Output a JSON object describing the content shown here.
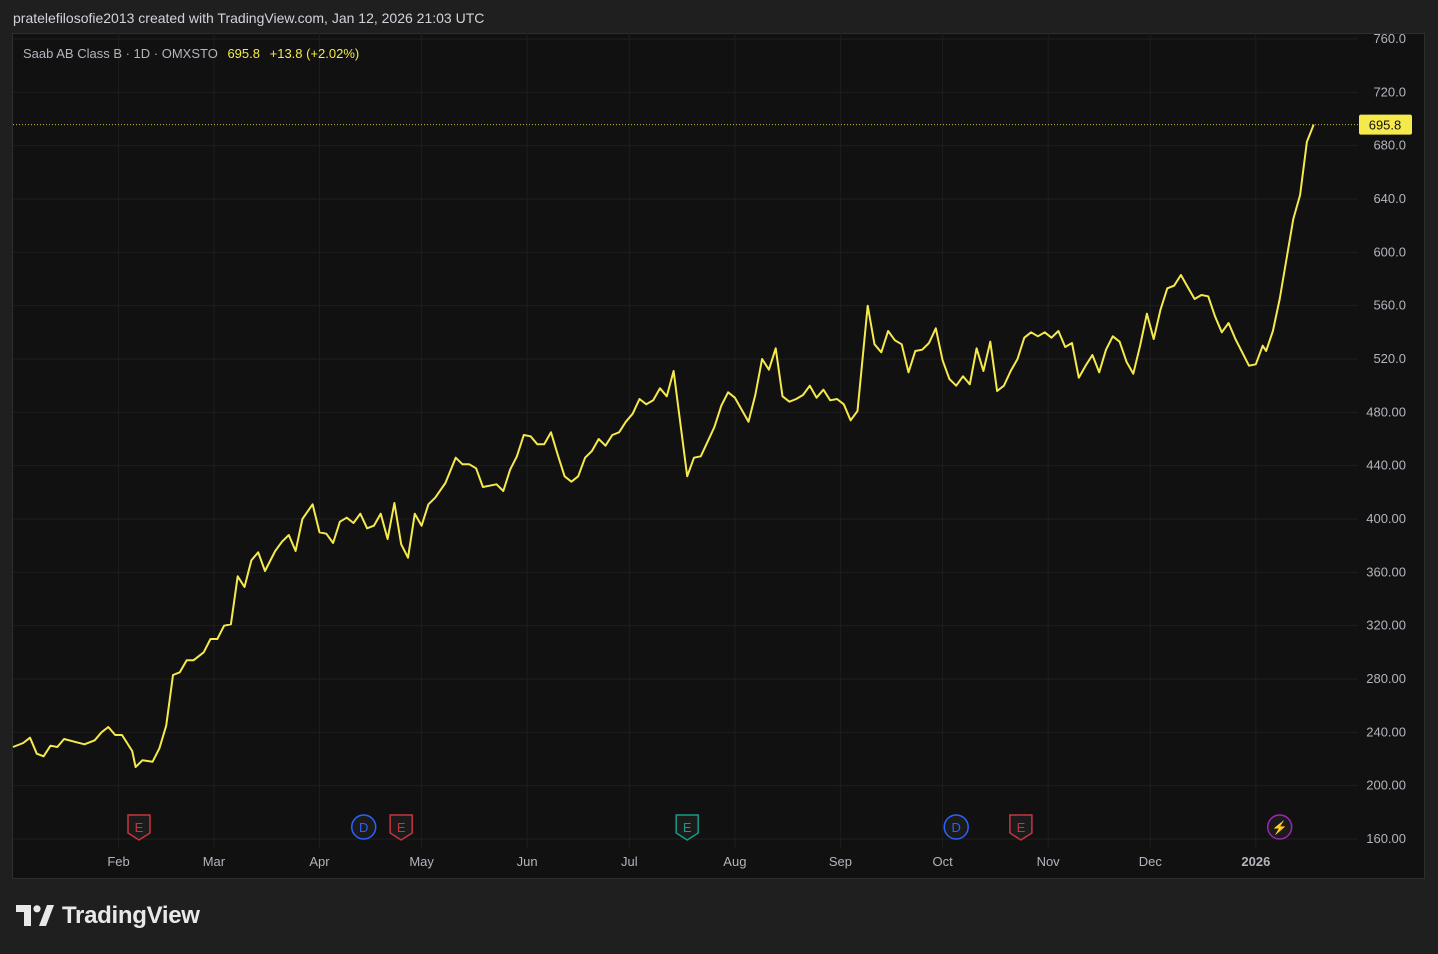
{
  "header": {
    "attribution": "pratelefilosofie2013 created with TradingView.com, Jan 12, 2026 21:03 UTC"
  },
  "legend": {
    "symbol": "Saab AB Class B · 1D · OMXSTO",
    "last_price": "695.8",
    "change": "+13.8 (+2.02%)"
  },
  "price_label": "695.8",
  "footer": {
    "brand": "TradingView",
    "logo_icon": "tradingview-logo-icon"
  },
  "colors": {
    "line": "#f5e94b",
    "background": "#111111",
    "grid": "#1e1e1e",
    "earnings_red": "#c9353f",
    "earnings_teal": "#1a9a86",
    "dividend_blue": "#2962ff",
    "news_purple": "#9c27b0"
  },
  "chart_data": {
    "type": "line",
    "title": "Saab AB Class B · 1D · OMXSTO",
    "xlabel": "",
    "ylabel": "",
    "ylim": [
      160,
      760
    ],
    "yticks": [
      "760.0",
      "720.0",
      "680.0",
      "640.0",
      "600.0",
      "560.0",
      "520.0",
      "480.00",
      "440.00",
      "400.00",
      "360.00",
      "320.00",
      "280.00",
      "240.00",
      "200.00",
      "160.00"
    ],
    "xtick_labels": [
      "Feb",
      "Mar",
      "Apr",
      "May",
      "Jun",
      "Jul",
      "Aug",
      "Sep",
      "Oct",
      "Nov",
      "Dec",
      "2026"
    ],
    "xtick_dates": [
      "2025-02-01",
      "2025-03-01",
      "2025-04-01",
      "2025-05-01",
      "2025-06-01",
      "2025-07-01",
      "2025-08-01",
      "2025-09-01",
      "2025-10-01",
      "2025-11-01",
      "2025-12-01",
      "2026-01-01"
    ],
    "grid": true,
    "last_value": 695.8,
    "events": [
      {
        "kind": "earnings",
        "label": "E",
        "date": "2025-02-07",
        "color": "red"
      },
      {
        "kind": "dividend",
        "label": "D",
        "date": "2025-04-14",
        "color": "blue"
      },
      {
        "kind": "earnings",
        "label": "E",
        "date": "2025-04-25",
        "color": "red"
      },
      {
        "kind": "earnings",
        "label": "E",
        "date": "2025-07-18",
        "color": "teal"
      },
      {
        "kind": "dividend",
        "label": "D",
        "date": "2025-10-05",
        "color": "blue"
      },
      {
        "kind": "earnings",
        "label": "E",
        "date": "2025-10-24",
        "color": "red"
      },
      {
        "kind": "news",
        "label": "⚡",
        "date": "2026-01-08",
        "color": "purple"
      }
    ],
    "series": [
      {
        "points": [
          [
            "2025-01-01",
            229
          ],
          [
            "2025-01-04",
            232
          ],
          [
            "2025-01-06",
            236
          ],
          [
            "2025-01-08",
            224
          ],
          [
            "2025-01-10",
            222
          ],
          [
            "2025-01-12",
            230
          ],
          [
            "2025-01-14",
            229
          ],
          [
            "2025-01-16",
            235
          ],
          [
            "2025-01-19",
            233
          ],
          [
            "2025-01-22",
            231
          ],
          [
            "2025-01-25",
            234
          ],
          [
            "2025-01-27",
            240
          ],
          [
            "2025-01-29",
            244
          ],
          [
            "2025-01-31",
            238
          ],
          [
            "2025-02-02",
            238
          ],
          [
            "2025-02-05",
            226
          ],
          [
            "2025-02-06",
            214
          ],
          [
            "2025-02-08",
            219
          ],
          [
            "2025-02-11",
            218
          ],
          [
            "2025-02-13",
            228
          ],
          [
            "2025-02-15",
            245
          ],
          [
            "2025-02-17",
            283
          ],
          [
            "2025-02-19",
            285
          ],
          [
            "2025-02-21",
            294
          ],
          [
            "2025-02-23",
            294
          ],
          [
            "2025-02-26",
            300
          ],
          [
            "2025-02-28",
            310
          ],
          [
            "2025-03-02",
            310
          ],
          [
            "2025-03-04",
            320
          ],
          [
            "2025-03-06",
            321
          ],
          [
            "2025-03-08",
            357
          ],
          [
            "2025-03-10",
            349
          ],
          [
            "2025-03-12",
            369
          ],
          [
            "2025-03-14",
            375
          ],
          [
            "2025-03-16",
            361
          ],
          [
            "2025-03-19",
            376
          ],
          [
            "2025-03-21",
            383
          ],
          [
            "2025-03-23",
            388
          ],
          [
            "2025-03-25",
            376
          ],
          [
            "2025-03-27",
            400
          ],
          [
            "2025-03-30",
            411
          ],
          [
            "2025-04-01",
            390
          ],
          [
            "2025-04-03",
            389
          ],
          [
            "2025-04-05",
            382
          ],
          [
            "2025-04-07",
            398
          ],
          [
            "2025-04-09",
            401
          ],
          [
            "2025-04-11",
            397
          ],
          [
            "2025-04-13",
            404
          ],
          [
            "2025-04-15",
            393
          ],
          [
            "2025-04-17",
            395
          ],
          [
            "2025-04-19",
            404
          ],
          [
            "2025-04-21",
            385
          ],
          [
            "2025-04-23",
            412
          ],
          [
            "2025-04-25",
            381
          ],
          [
            "2025-04-27",
            371
          ],
          [
            "2025-04-29",
            404
          ],
          [
            "2025-05-01",
            395
          ],
          [
            "2025-05-03",
            411
          ],
          [
            "2025-05-05",
            416
          ],
          [
            "2025-05-08",
            427
          ],
          [
            "2025-05-11",
            446
          ],
          [
            "2025-05-13",
            441
          ],
          [
            "2025-05-15",
            441
          ],
          [
            "2025-05-17",
            438
          ],
          [
            "2025-05-19",
            424
          ],
          [
            "2025-05-21",
            425
          ],
          [
            "2025-05-23",
            426
          ],
          [
            "2025-05-25",
            421
          ],
          [
            "2025-05-27",
            437
          ],
          [
            "2025-05-29",
            447
          ],
          [
            "2025-05-31",
            463
          ],
          [
            "2025-06-02",
            462
          ],
          [
            "2025-06-04",
            456
          ],
          [
            "2025-06-06",
            456
          ],
          [
            "2025-06-08",
            465
          ],
          [
            "2025-06-10",
            448
          ],
          [
            "2025-06-12",
            432
          ],
          [
            "2025-06-14",
            428
          ],
          [
            "2025-06-16",
            432
          ],
          [
            "2025-06-18",
            446
          ],
          [
            "2025-06-20",
            451
          ],
          [
            "2025-06-22",
            460
          ],
          [
            "2025-06-24",
            455
          ],
          [
            "2025-06-26",
            463
          ],
          [
            "2025-06-28",
            465
          ],
          [
            "2025-06-30",
            473
          ],
          [
            "2025-07-02",
            479
          ],
          [
            "2025-07-04",
            490
          ],
          [
            "2025-07-06",
            486
          ],
          [
            "2025-07-08",
            489
          ],
          [
            "2025-07-10",
            498
          ],
          [
            "2025-07-12",
            492
          ],
          [
            "2025-07-14",
            511
          ],
          [
            "2025-07-18",
            432
          ],
          [
            "2025-07-20",
            446
          ],
          [
            "2025-07-22",
            447
          ],
          [
            "2025-07-24",
            458
          ],
          [
            "2025-07-26",
            469
          ],
          [
            "2025-07-28",
            485
          ],
          [
            "2025-07-30",
            495
          ],
          [
            "2025-08-01",
            491
          ],
          [
            "2025-08-03",
            482
          ],
          [
            "2025-08-05",
            473
          ],
          [
            "2025-08-07",
            493
          ],
          [
            "2025-08-09",
            520
          ],
          [
            "2025-08-11",
            512
          ],
          [
            "2025-08-13",
            528
          ],
          [
            "2025-08-15",
            492
          ],
          [
            "2025-08-17",
            488
          ],
          [
            "2025-08-19",
            490
          ],
          [
            "2025-08-21",
            493
          ],
          [
            "2025-08-23",
            500
          ],
          [
            "2025-08-25",
            491
          ],
          [
            "2025-08-27",
            497
          ],
          [
            "2025-08-29",
            489
          ],
          [
            "2025-08-31",
            490
          ],
          [
            "2025-09-02",
            486
          ],
          [
            "2025-09-04",
            474
          ],
          [
            "2025-09-06",
            481
          ],
          [
            "2025-09-09",
            560
          ],
          [
            "2025-09-11",
            531
          ],
          [
            "2025-09-13",
            525
          ],
          [
            "2025-09-15",
            541
          ],
          [
            "2025-09-17",
            534
          ],
          [
            "2025-09-19",
            531
          ],
          [
            "2025-09-21",
            510
          ],
          [
            "2025-09-23",
            526
          ],
          [
            "2025-09-25",
            527
          ],
          [
            "2025-09-27",
            532
          ],
          [
            "2025-09-29",
            543
          ],
          [
            "2025-10-01",
            519
          ],
          [
            "2025-10-03",
            505
          ],
          [
            "2025-10-05",
            500
          ],
          [
            "2025-10-07",
            507
          ],
          [
            "2025-10-09",
            501
          ],
          [
            "2025-10-11",
            528
          ],
          [
            "2025-10-13",
            511
          ],
          [
            "2025-10-15",
            533
          ],
          [
            "2025-10-17",
            496
          ],
          [
            "2025-10-19",
            500
          ],
          [
            "2025-10-21",
            511
          ],
          [
            "2025-10-23",
            520
          ],
          [
            "2025-10-25",
            536
          ],
          [
            "2025-10-27",
            540
          ],
          [
            "2025-10-29",
            537
          ],
          [
            "2025-10-31",
            540
          ],
          [
            "2025-11-02",
            536
          ],
          [
            "2025-11-04",
            541
          ],
          [
            "2025-11-06",
            529
          ],
          [
            "2025-11-08",
            532
          ],
          [
            "2025-11-10",
            506
          ],
          [
            "2025-11-12",
            515
          ],
          [
            "2025-11-14",
            523
          ],
          [
            "2025-11-16",
            510
          ],
          [
            "2025-11-18",
            527
          ],
          [
            "2025-11-20",
            537
          ],
          [
            "2025-11-22",
            533
          ],
          [
            "2025-11-24",
            518
          ],
          [
            "2025-11-26",
            509
          ],
          [
            "2025-11-28",
            530
          ],
          [
            "2025-11-30",
            554
          ],
          [
            "2025-12-02",
            535
          ],
          [
            "2025-12-04",
            557
          ],
          [
            "2025-12-06",
            573
          ],
          [
            "2025-12-08",
            575
          ],
          [
            "2025-12-10",
            583
          ],
          [
            "2025-12-12",
            574
          ],
          [
            "2025-12-14",
            565
          ],
          [
            "2025-12-16",
            568
          ],
          [
            "2025-12-18",
            567
          ],
          [
            "2025-12-20",
            552
          ],
          [
            "2025-12-22",
            540
          ],
          [
            "2025-12-24",
            547
          ],
          [
            "2025-12-26",
            535
          ],
          [
            "2025-12-28",
            525
          ],
          [
            "2025-12-30",
            515
          ]
        ]
      }
    ]
  }
}
